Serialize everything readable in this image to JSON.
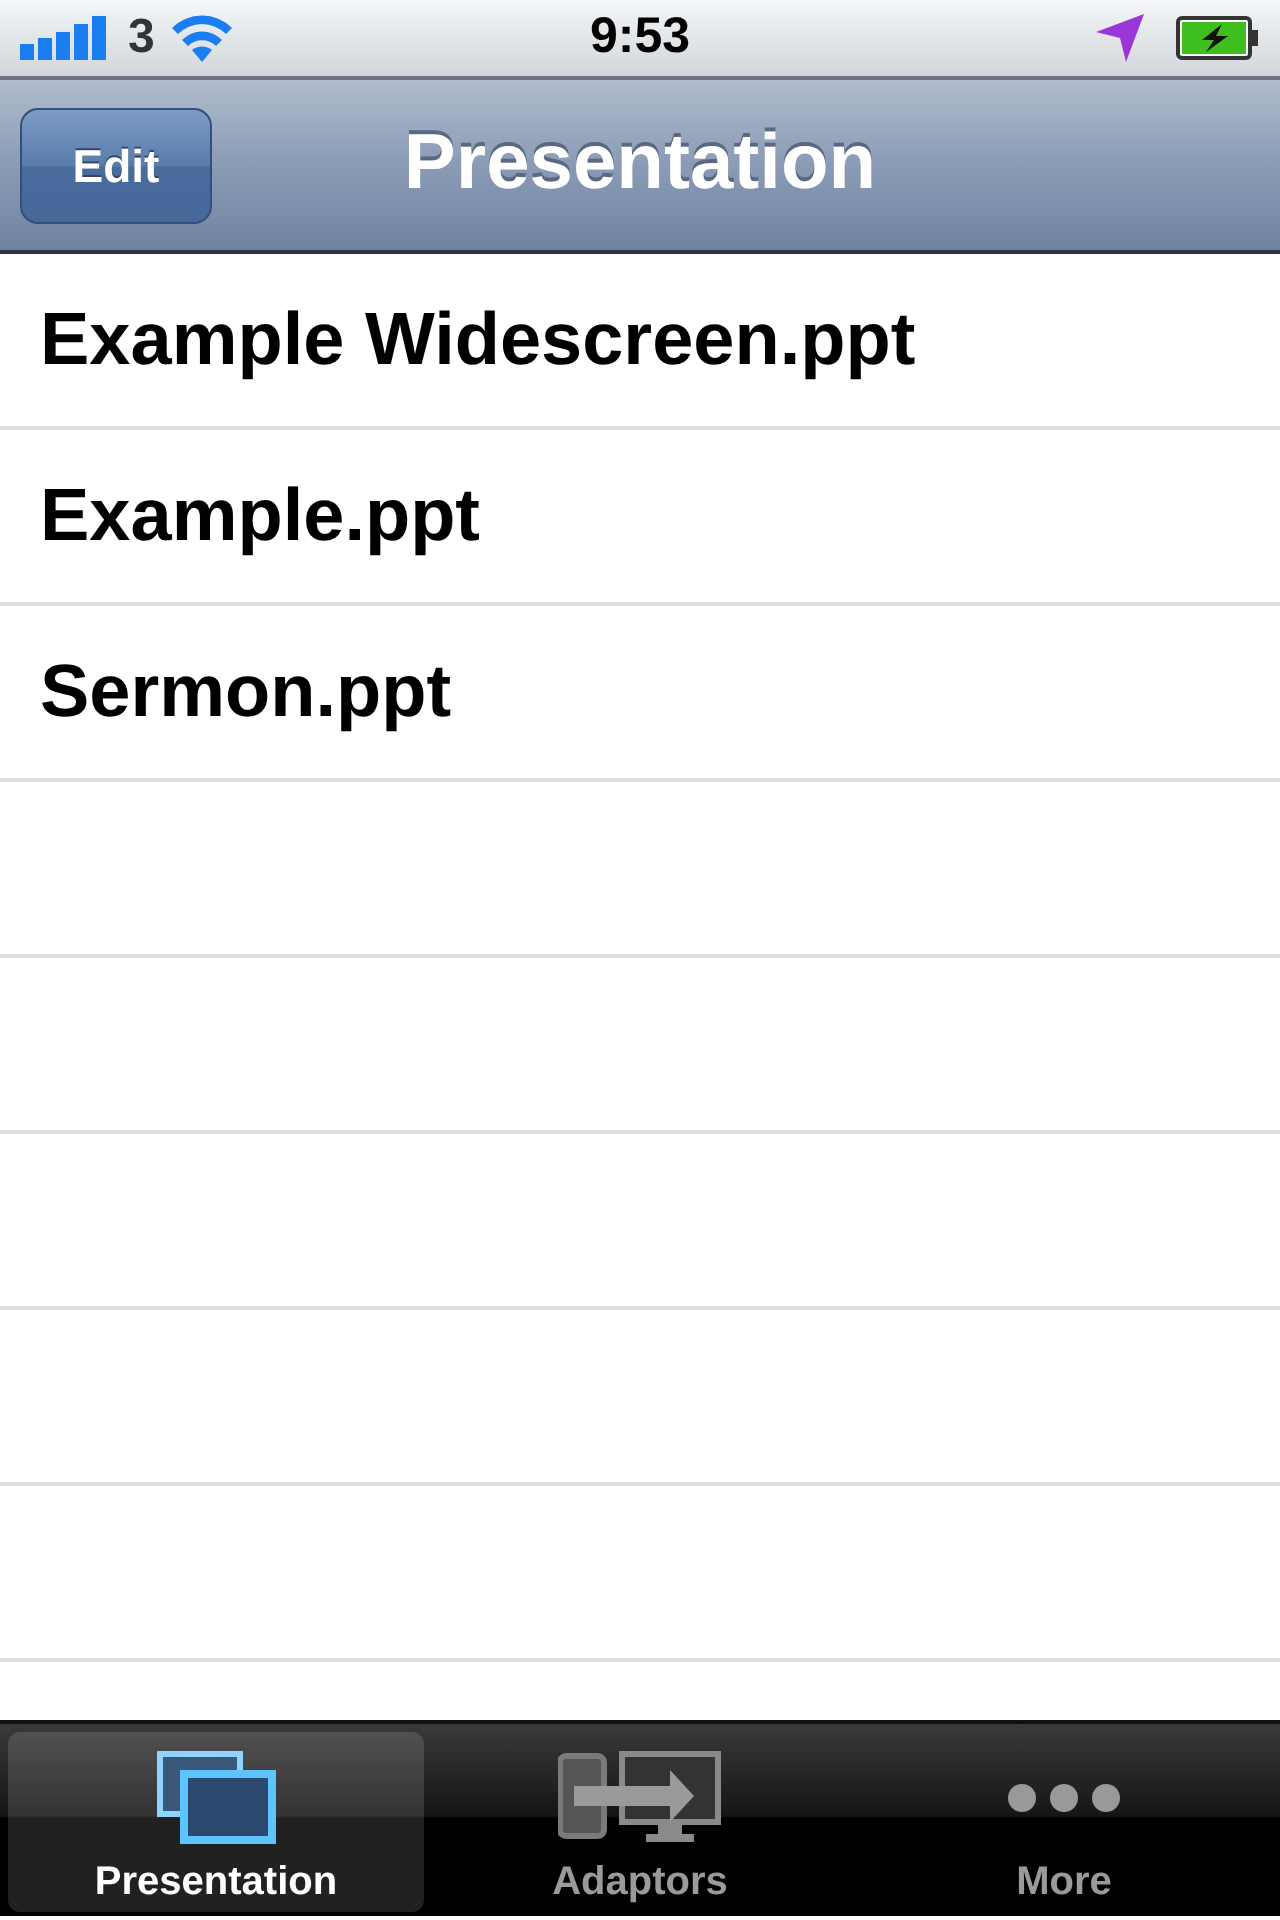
{
  "status_bar": {
    "carrier": "3",
    "time": "9:53"
  },
  "nav_bar": {
    "edit_button": "Edit",
    "title": "Presentation"
  },
  "files": [
    {
      "name": "Example Widescreen.ppt"
    },
    {
      "name": "Example.ppt"
    },
    {
      "name": "Sermon.ppt"
    }
  ],
  "tabs": [
    {
      "label": "Presentation",
      "kind": "screens",
      "selected": true
    },
    {
      "label": "Adaptors",
      "kind": "adaptor",
      "selected": false
    },
    {
      "label": "More",
      "kind": "more",
      "selected": false
    }
  ]
}
